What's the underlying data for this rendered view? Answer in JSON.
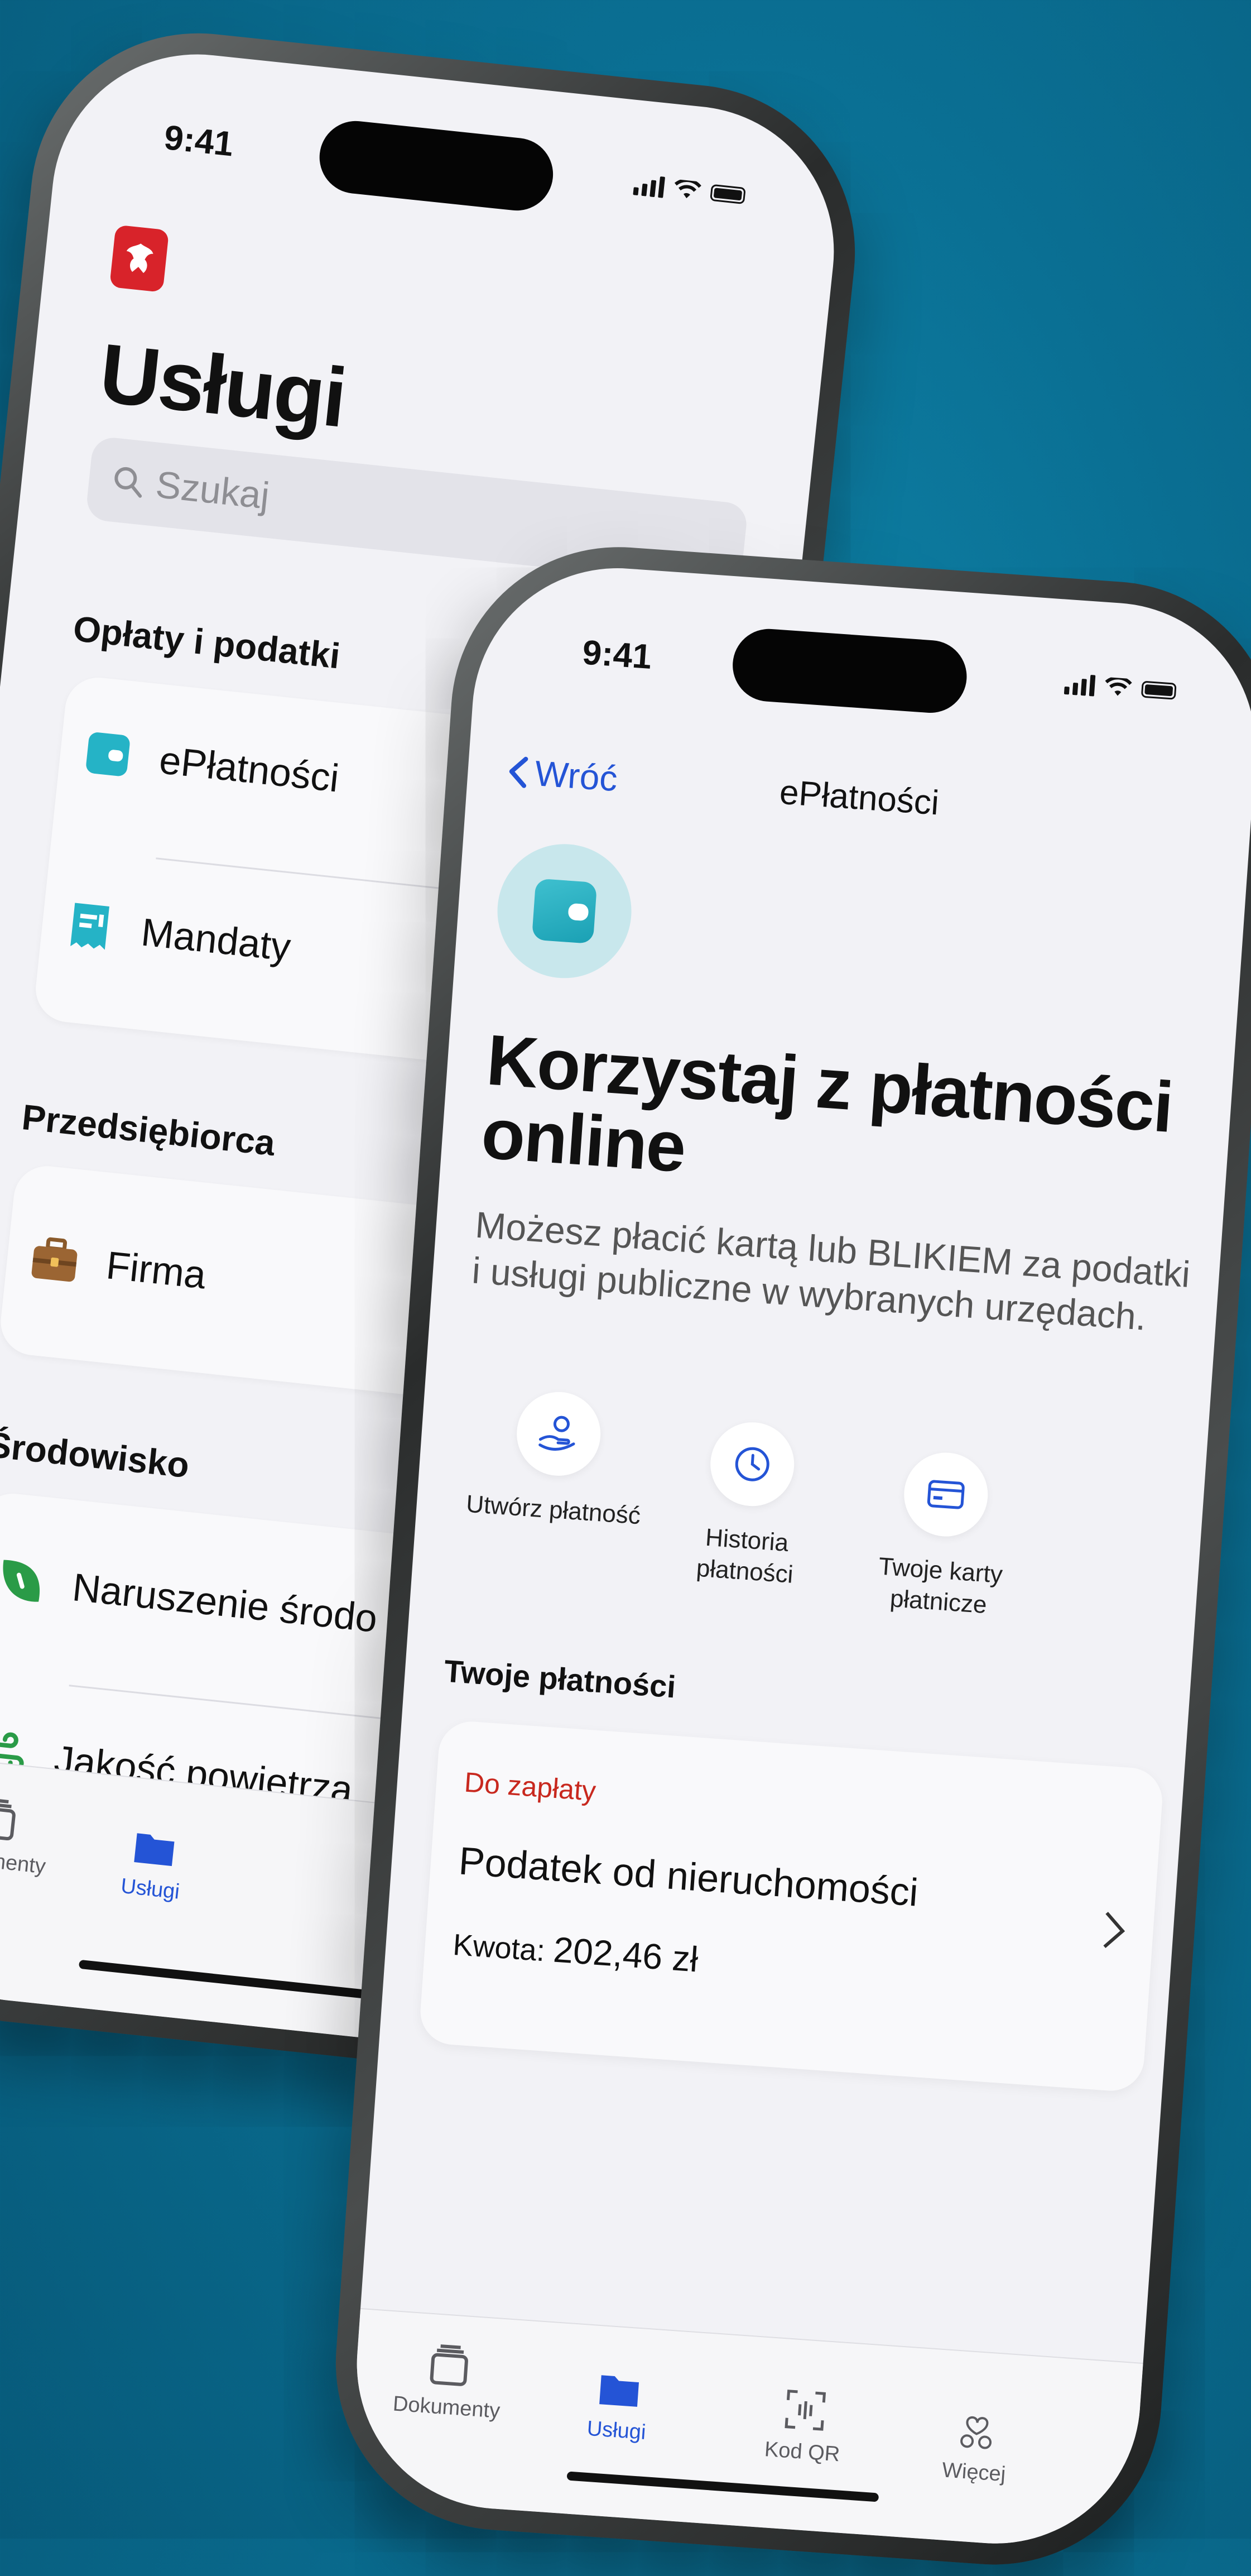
{
  "back_phone": {
    "status_time": "9:41",
    "title": "Usługi",
    "search_placeholder": "Szukaj",
    "sections": [
      {
        "label": "Opłaty i podatki",
        "items": [
          "ePłatności",
          "Mandaty"
        ]
      },
      {
        "label": "Przedsiębiorca",
        "items": [
          "Firma"
        ]
      },
      {
        "label": "Środowisko",
        "items": [
          "Naruszenie środo",
          "Jakość powietrza"
        ]
      }
    ],
    "tabs": {
      "dokumenty": "Dokumenty",
      "uslugi": "Usługi"
    }
  },
  "front_phone": {
    "status_time": "9:41",
    "back_label": "Wróć",
    "nav_title": "ePłatności",
    "headline": "Korzystaj z płatności online",
    "lead": "Możesz płacić kartą lub BLIKIEM za podatki i usługi publiczne w wybranych urzędach.",
    "actions": {
      "create": "Utwórz płatność",
      "history": "Historia płatności",
      "cards": "Twoje karty płatnicze"
    },
    "payments_title": "Twoje płatności",
    "payment": {
      "status": "Do zapłaty",
      "name": "Podatek od nieruchomości",
      "amount_label": "Kwota:",
      "amount_value": "202,46 zł"
    },
    "tabs": {
      "dokumenty": "Dokumenty",
      "uslugi": "Usługi",
      "kod_qr": "Kod QR",
      "wiecej": "Więcej"
    }
  },
  "colors": {
    "accent": "#2454d6",
    "due_red": "#c8281e",
    "background": "#0a6f93"
  },
  "icons": [
    "eagle-logo-icon",
    "search-icon",
    "wallet-icon",
    "ticket-icon",
    "briefcase-icon",
    "leaf-icon",
    "wind-icon",
    "documents-icon",
    "folder-icon",
    "qr-code-icon",
    "more-icon",
    "chevron-left-icon",
    "chevron-right-icon",
    "hand-coin-icon",
    "clock-icon",
    "card-icon"
  ]
}
